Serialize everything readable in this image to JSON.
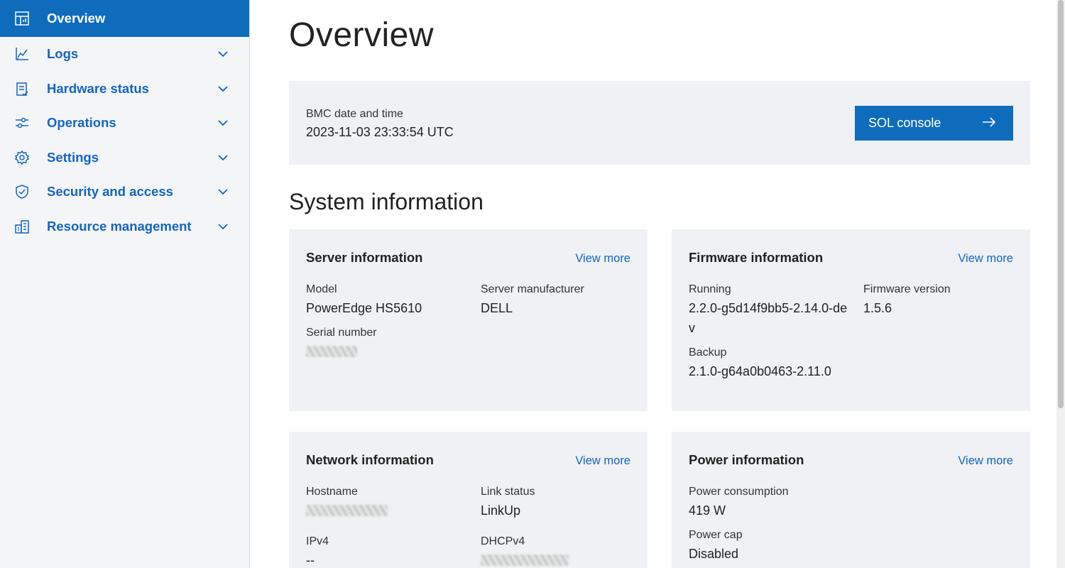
{
  "sidebar": {
    "items": [
      {
        "label": "Overview",
        "icon": "dashboard-icon"
      },
      {
        "label": "Logs",
        "icon": "chart-icon"
      },
      {
        "label": "Hardware status",
        "icon": "clipboard-icon"
      },
      {
        "label": "Operations",
        "icon": "sliders-icon"
      },
      {
        "label": "Settings",
        "icon": "gear-icon"
      },
      {
        "label": "Security and access",
        "icon": "shield-icon"
      },
      {
        "label": "Resource management",
        "icon": "resources-icon"
      }
    ]
  },
  "page": {
    "title": "Overview"
  },
  "bmc": {
    "label": "BMC date and time",
    "value": "2023-11-03 23:33:54 UTC"
  },
  "sol_button": {
    "label": "SOL console",
    "icon": "arrow-right-icon"
  },
  "system_section": {
    "title": "System information"
  },
  "cards": {
    "server": {
      "title": "Server information",
      "view_more": "View more",
      "model_label": "Model",
      "model_value": "PowerEdge HS5610",
      "manufacturer_label": "Server manufacturer",
      "manufacturer_value": "DELL",
      "serial_label": "Serial number"
    },
    "firmware": {
      "title": "Firmware information",
      "view_more": "View more",
      "running_label": "Running",
      "running_value": "2.2.0-g5d14f9bb5-2.14.0-dev",
      "version_label": "Firmware version",
      "version_value": "1.5.6",
      "backup_label": "Backup",
      "backup_value": "2.1.0-g64a0b0463-2.11.0"
    },
    "network": {
      "title": "Network information",
      "view_more": "View more",
      "hostname_label": "Hostname",
      "link_label": "Link status",
      "link_value": "LinkUp",
      "ipv4_label": "IPv4",
      "ipv4_value": "--",
      "dhcp_label": "DHCPv4"
    },
    "power": {
      "title": "Power information",
      "view_more": "View more",
      "consumption_label": "Power consumption",
      "consumption_value": "419 W",
      "cap_label": "Power cap",
      "cap_value": "Disabled"
    }
  },
  "colors": {
    "accent": "#0f6cbd",
    "link": "#1565c0",
    "panel": "#eff1f4",
    "sidebar": "#f4f5f7"
  }
}
